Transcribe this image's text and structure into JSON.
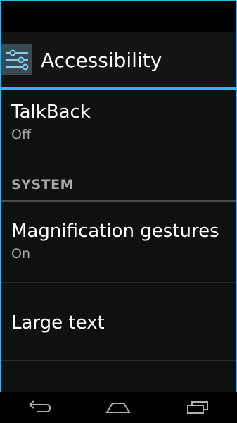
{
  "actionbar": {
    "title": "Accessibility",
    "icon": "settings-sliders-icon"
  },
  "items": [
    {
      "label": "TalkBack",
      "summary": "Off"
    },
    {
      "label": "Magnification gestures",
      "summary": "On"
    },
    {
      "label": "Large text"
    }
  ],
  "section": {
    "title": "SYSTEM"
  },
  "navbar": {
    "back_icon": "back-icon",
    "home_icon": "home-icon",
    "recents_icon": "recents-icon"
  },
  "colors": {
    "accent": "#33b5e5",
    "background": "#101010",
    "summary_text": "#a8a8a8"
  }
}
